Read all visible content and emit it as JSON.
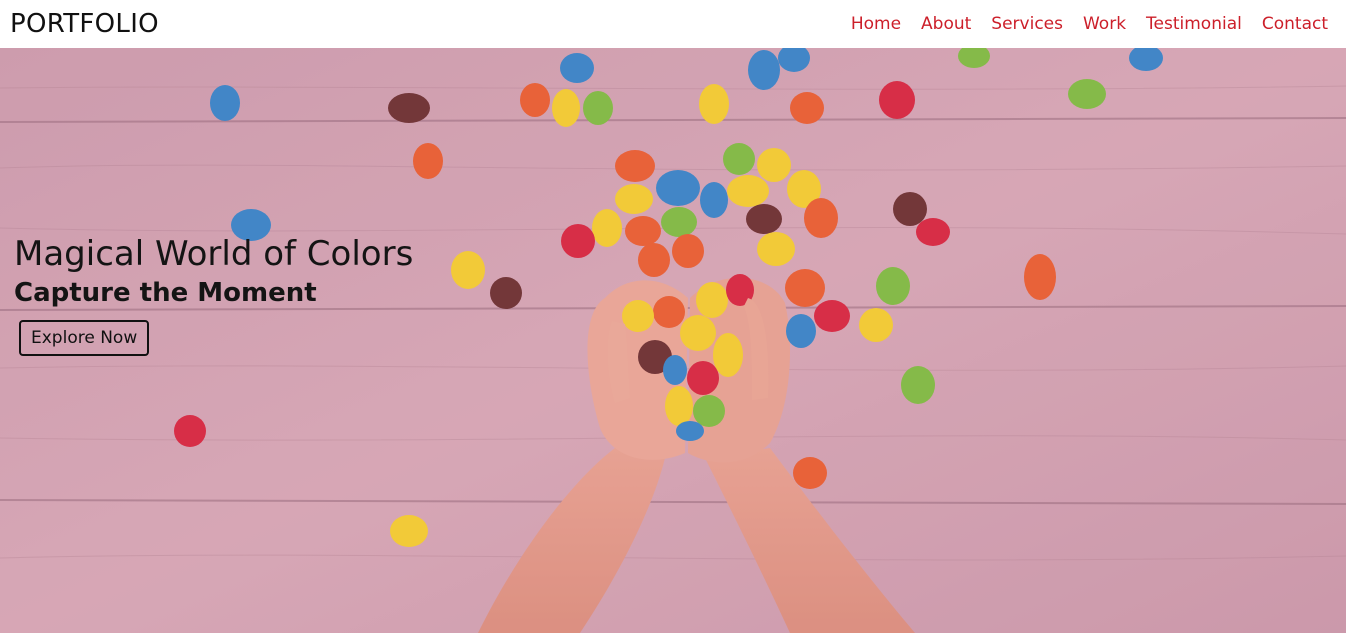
{
  "brand": {
    "logo": "PORTFOLIO"
  },
  "nav": {
    "links": [
      {
        "label": "Home"
      },
      {
        "label": "About"
      },
      {
        "label": "Services"
      },
      {
        "label": "Work"
      },
      {
        "label": "Testimonial"
      },
      {
        "label": "Contact"
      }
    ]
  },
  "hero": {
    "title": "Magical World of Colors",
    "subtitle": "Capture the Moment",
    "cta_label": "Explore Now"
  },
  "colors": {
    "accent": "#cc1f2a",
    "candy": [
      "#1e7fc8",
      "#f5d21a",
      "#e8531b",
      "#6fbf2f",
      "#d3142c",
      "#5a1f1c"
    ]
  }
}
